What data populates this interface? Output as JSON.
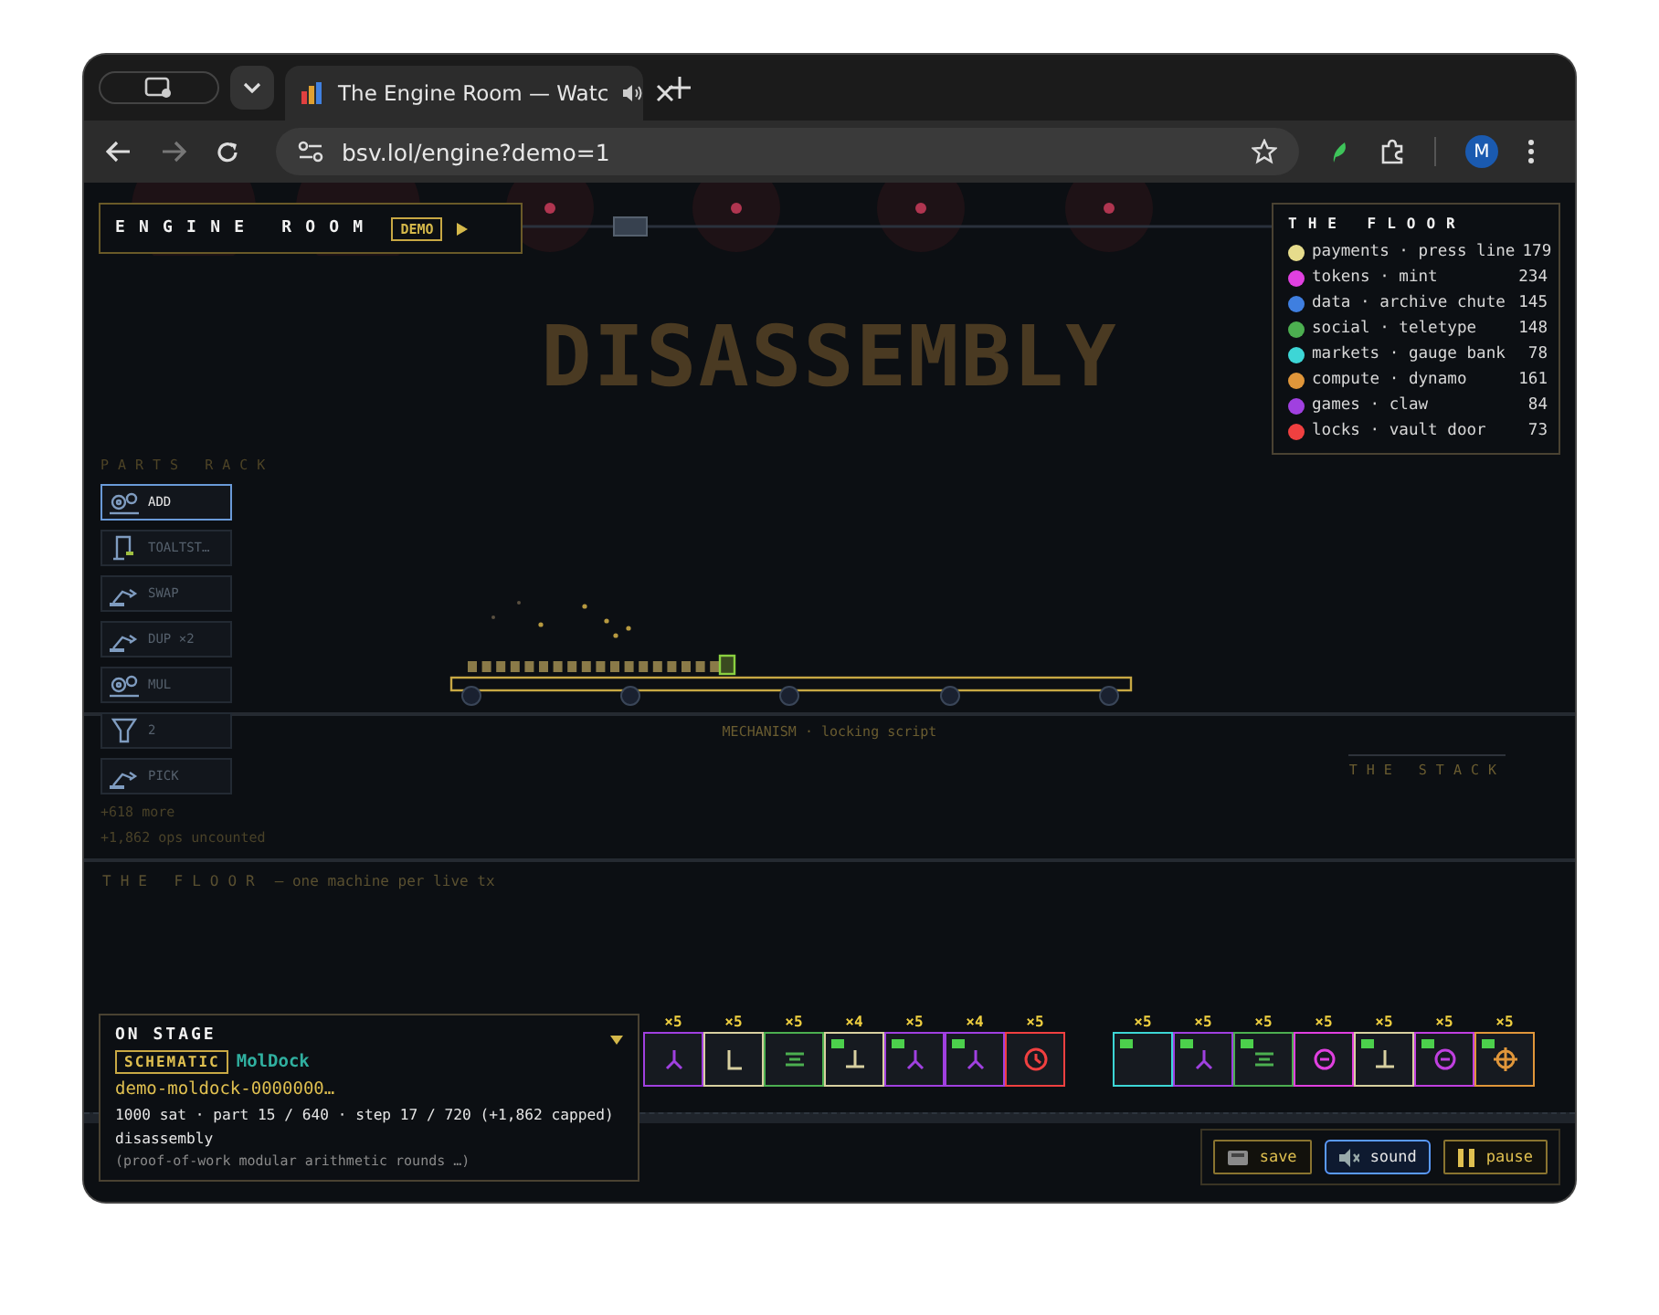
{
  "browser": {
    "tab_title": "The Engine Room — Watc",
    "url": "bsv.lol/engine?demo=1",
    "avatar": "M"
  },
  "header": {
    "title": "ENGINE ROOM",
    "badge": "DEMO"
  },
  "headline": "DISASSEMBLY",
  "floor_legend": {
    "title": "THE FLOOR",
    "items": [
      {
        "label": "payments · press line",
        "count": "179",
        "color": "#e6dc8c"
      },
      {
        "label": "tokens · mint",
        "count": "234",
        "color": "#e040e0"
      },
      {
        "label": "data · archive chute",
        "count": "145",
        "color": "#3f7fe0"
      },
      {
        "label": "social · teletype",
        "count": "148",
        "color": "#4caf50"
      },
      {
        "label": "markets · gauge bank",
        "count": "78",
        "color": "#3dd6d6"
      },
      {
        "label": "compute · dynamo",
        "count": "161",
        "color": "#e0963a"
      },
      {
        "label": "games · claw",
        "count": "84",
        "color": "#a040e0"
      },
      {
        "label": "locks · vault door",
        "count": "73",
        "color": "#f04040"
      }
    ]
  },
  "parts_rack": {
    "title": "PARTS RACK",
    "items": [
      {
        "label": "ADD",
        "kind": "gears",
        "selected": true
      },
      {
        "label": "TOALTST…",
        "kind": "crane",
        "selected": false
      },
      {
        "label": "SWAP",
        "kind": "arm",
        "selected": false
      },
      {
        "label": "DUP ×2",
        "kind": "arm",
        "selected": false
      },
      {
        "label": "MUL",
        "kind": "gears",
        "selected": false
      },
      {
        "label": "2",
        "kind": "funnel",
        "selected": false
      },
      {
        "label": "PICK",
        "kind": "arm",
        "selected": false
      }
    ],
    "more": "+618 more",
    "uncounted": "+1,862 ops uncounted"
  },
  "mechanism": {
    "caption": "MECHANISM · locking script"
  },
  "stack": {
    "title": "THE STACK"
  },
  "floor": {
    "title": "THE FLOOR",
    "subtitle": "— one machine per live tx",
    "clusters": [
      {
        "machines": [
          {
            "multiplier": "×5",
            "kind": "fork",
            "color": "#a040e0",
            "lamp": false
          },
          {
            "multiplier": "×5",
            "kind": "corner",
            "color": "#d8d0a0",
            "lamp": false
          },
          {
            "multiplier": "×5",
            "kind": "lines",
            "color": "#4caf50",
            "lamp": false
          },
          {
            "multiplier": "×4",
            "kind": "tee",
            "color": "#d8d0a0",
            "lamp": true
          },
          {
            "multiplier": "×5",
            "kind": "fork",
            "color": "#a040e0",
            "lamp": true
          },
          {
            "multiplier": "×4",
            "kind": "fork",
            "color": "#a040e0",
            "lamp": true
          },
          {
            "multiplier": "×5",
            "kind": "clock",
            "color": "#f04040",
            "lamp": false
          }
        ]
      },
      {
        "machines": [
          {
            "multiplier": "×5",
            "kind": "blank",
            "color": "#3dd6d6",
            "lamp": true
          },
          {
            "multiplier": "×5",
            "kind": "fork",
            "color": "#a040e0",
            "lamp": true
          },
          {
            "multiplier": "×5",
            "kind": "lines",
            "color": "#4caf50",
            "lamp": true
          },
          {
            "multiplier": "×5",
            "kind": "minus",
            "color": "#e040e0",
            "lamp": false
          },
          {
            "multiplier": "×5",
            "kind": "tee",
            "color": "#d8d0a0",
            "lamp": true
          },
          {
            "multiplier": "×5",
            "kind": "minus",
            "color": "#c040e0",
            "lamp": true
          },
          {
            "multiplier": "×5",
            "kind": "crosshair",
            "color": "#e0963a",
            "lamp": true
          }
        ]
      }
    ]
  },
  "on_stage": {
    "title": "ON STAGE",
    "badge": "SCHEMATIC",
    "name": "MolDock",
    "id": "demo-moldock-0000000…",
    "stats": "1000 sat · part 15 / 640 · step 17 / 720 (+1,862 capped)",
    "phase": "disassembly",
    "note": "(proof-of-work modular arithmetic rounds …)"
  },
  "controls": [
    {
      "label": "save",
      "kind": "save",
      "selected": false
    },
    {
      "label": "sound",
      "kind": "sound",
      "selected": true
    },
    {
      "label": "pause",
      "kind": "pause",
      "selected": false
    }
  ]
}
